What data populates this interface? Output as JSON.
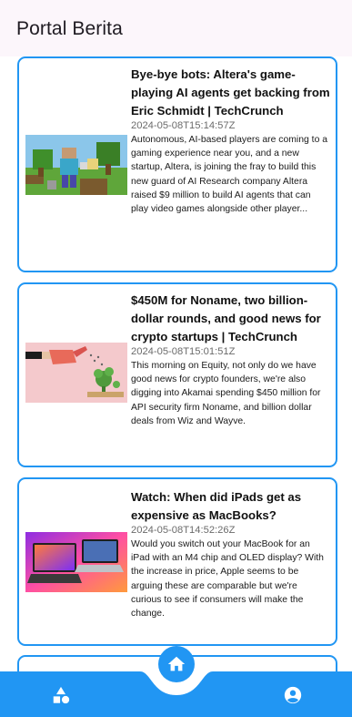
{
  "app": {
    "title": "Portal Berita"
  },
  "articles": [
    {
      "title": "Bye-bye bots: Altera's game-playing AI agents get backing from Eric Schmidt | TechCrunch",
      "date": "2024-05-08T15:14:57Z",
      "description": "Autonomous, AI-based players are coming to a gaming experience near you, and a new startup, Altera, is joining the fray to build this new guard of AI Research company Altera raised $9 million to build AI agents that can play video games alongside other player..."
    },
    {
      "title": "$450M for Noname, two billion-dollar rounds, and good news for crypto startups | TechCrunch",
      "date": "2024-05-08T15:01:51Z",
      "description": "This morning on Equity, not only do we have good news for crypto founders, we're also digging into Akamai spending $450 million for API security firm Noname, and billion dollar deals from Wiz and Wayve."
    },
    {
      "title": "Watch: When did iPads get as expensive as MacBooks?",
      "date": "2024-05-08T14:52:26Z",
      "description": "Would you switch out your MacBook for an iPad with an M4 chip and OLED display? With the increase in price, Apple seems to be arguing these are comparable but we're curious to see if consumers will make the change."
    }
  ],
  "nav": {
    "left_icon": "category-shapes-icon",
    "center_icon": "home-icon",
    "right_icon": "account-circle-icon",
    "accent": "#2196f3"
  }
}
